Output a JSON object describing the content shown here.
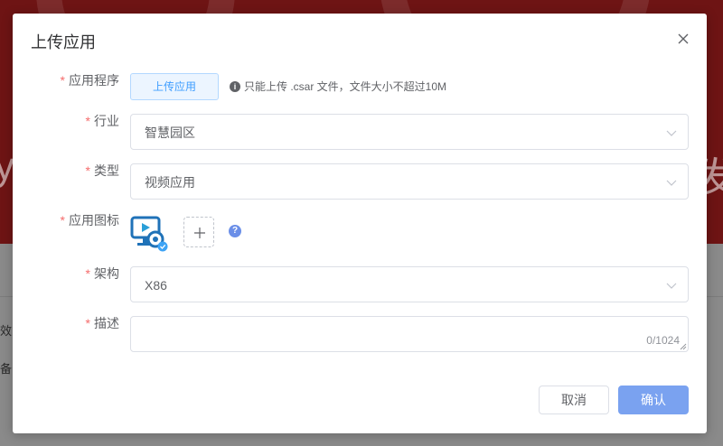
{
  "background": {
    "hero_glyph_left": "y",
    "hero_glyph_right": "发",
    "edge_text_1": "效",
    "edge_text_2": "备"
  },
  "modal": {
    "title": "上传应用",
    "close_icon": "close-icon"
  },
  "form": {
    "required_mark": "*",
    "application": {
      "label": "应用程序",
      "upload_button": "上传应用",
      "tip_icon": "i",
      "tip": "只能上传 .csar 文件，文件大小不超过10M"
    },
    "industry": {
      "label": "行业",
      "value": "智慧园区"
    },
    "type": {
      "label": "类型",
      "value": "视频应用"
    },
    "app_icon": {
      "label": "应用图标",
      "icon": "video-monitor-icon",
      "help": "?"
    },
    "architecture": {
      "label": "架构",
      "value": "X86"
    },
    "description": {
      "label": "描述",
      "value": "",
      "counter": "0/1024"
    }
  },
  "footer": {
    "cancel": "取消",
    "confirm": "确认"
  },
  "colors": {
    "primary": "#409eff",
    "confirm_button": "#7aa2f0",
    "required": "#f56c6c",
    "hero_background": "#6e1414"
  }
}
